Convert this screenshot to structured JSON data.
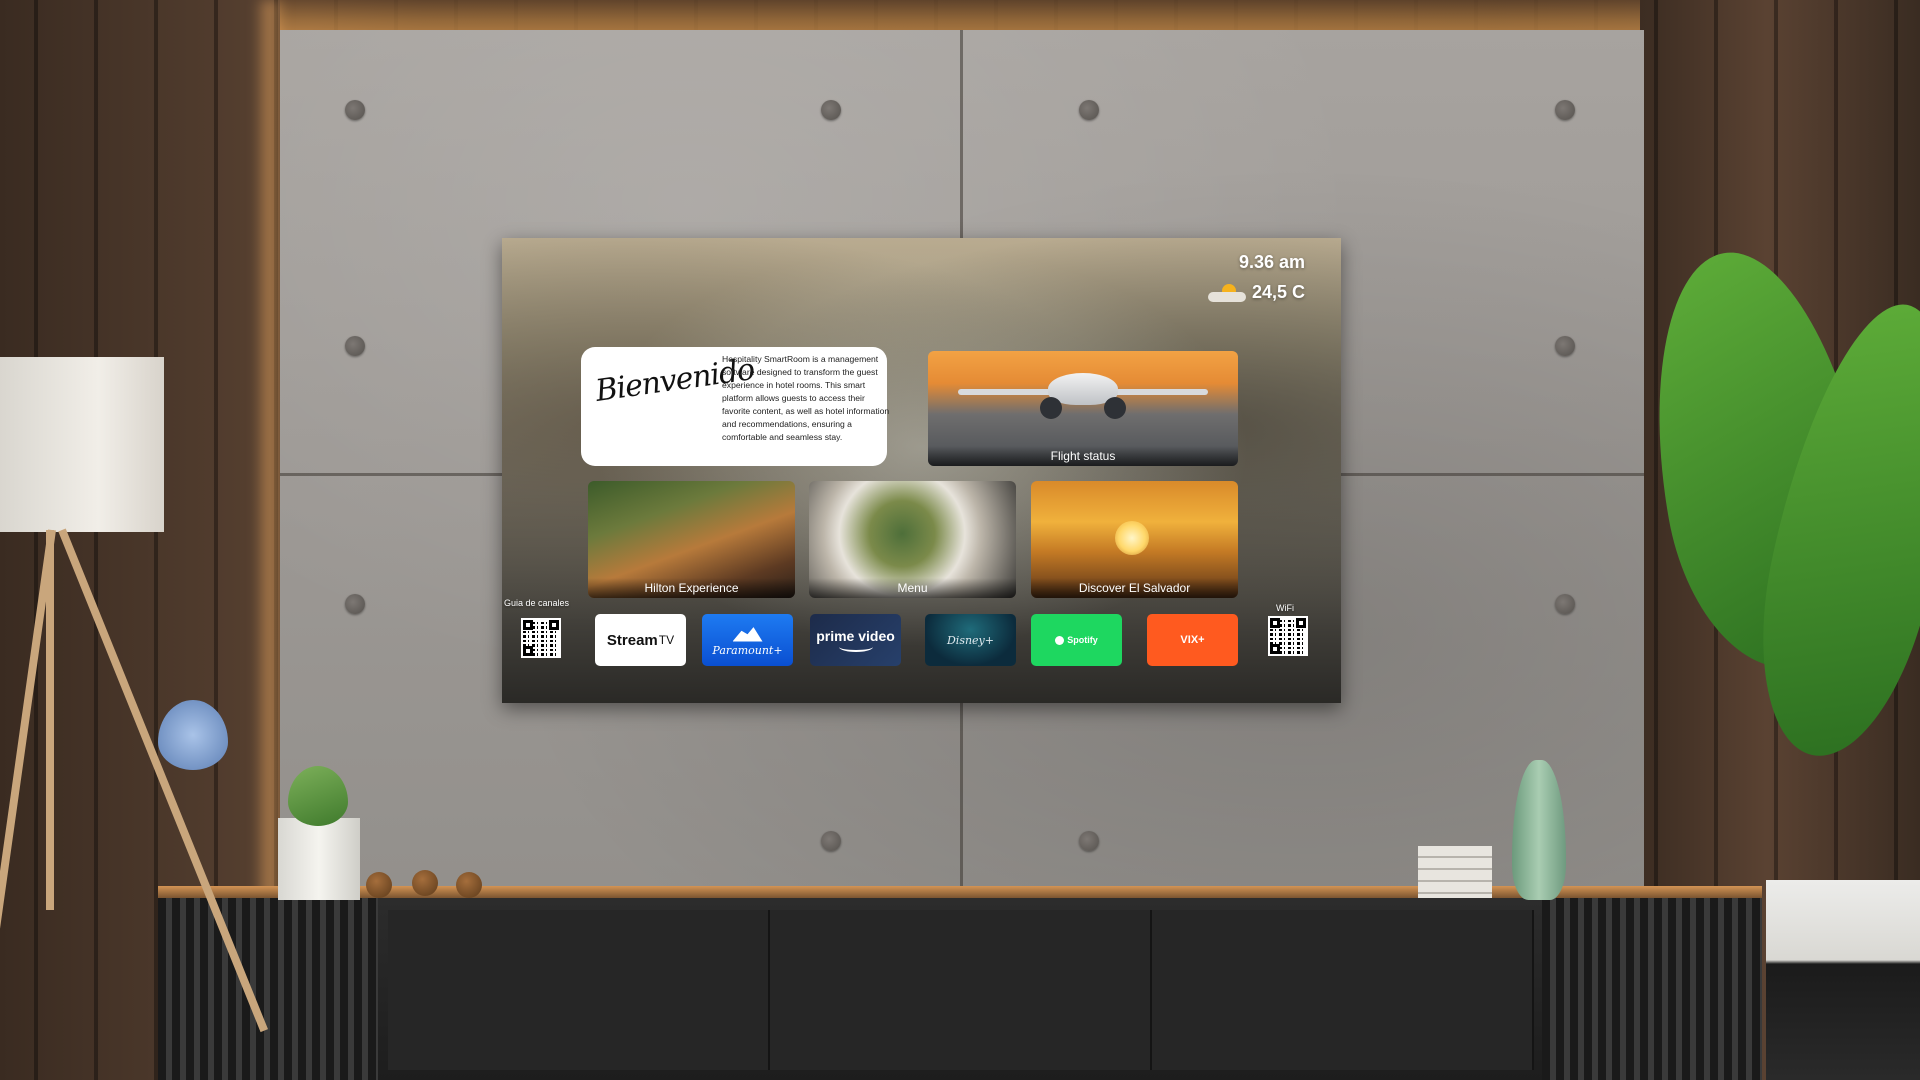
{
  "tv": {
    "time": "9.36 am",
    "temperature": "24,5 C",
    "weather_icon": "partly-sunny-icon",
    "welcome": {
      "title": "Bienvenido",
      "description": "Hospitality SmartRoom is a management software designed to transform the guest experience in hotel rooms. This smart platform allows guests to access their favorite content, as well as hotel information and recommendations, ensuring a comfortable and seamless stay."
    },
    "tiles": {
      "flight": "Flight status",
      "hilton": "Hilton Experience",
      "menu": "Menu",
      "discover": "Discover El Salvador"
    },
    "channel_guide_label": "Guia de canales",
    "wifi_label": "WiFi",
    "apps": {
      "stream_main": "Stream",
      "stream_suffix": "TV",
      "paramount": "Paramount+",
      "prime": "prime video",
      "disney": "Disney+",
      "spotify": "Spotify",
      "vix": "VIX+"
    }
  },
  "colors": {
    "paramount": "#0a4fd1",
    "prime": "#1d2b4a",
    "spotify": "#1ed760",
    "vix": "#ff5a1f",
    "disney": "#0c2b3c"
  }
}
